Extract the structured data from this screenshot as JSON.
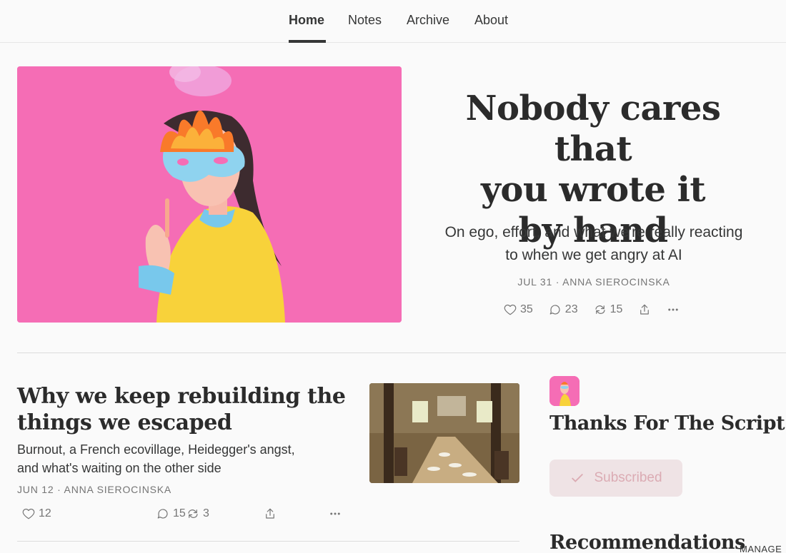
{
  "nav": {
    "items": [
      {
        "label": "Home",
        "active": true
      },
      {
        "label": "Notes",
        "active": false
      },
      {
        "label": "Archive",
        "active": false
      },
      {
        "label": "About",
        "active": false
      }
    ]
  },
  "hero": {
    "title": "Nobody cares that you wrote it by hand",
    "title_lines": [
      "Nobody cares that",
      "you wrote it",
      "by hand"
    ],
    "subtitle_lines": [
      "On ego, effort, and what we're really reacting",
      "to when we get angry at AI"
    ],
    "meta": "JUL 31 · ANNA SIEROCINSKA",
    "likes": "35",
    "comments": "23",
    "restacks": "15",
    "icons": [
      "heart-icon",
      "comment-icon",
      "restack-icon",
      "share-icon",
      "more-icon"
    ]
  },
  "post": {
    "title_lines": [
      "Why we keep rebuilding the",
      "things we escaped"
    ],
    "subtitle_lines": [
      "Burnout, a French ecovillage, Heidegger's angst,",
      "and what's waiting on the other side"
    ],
    "meta": "JUN 12 · ANNA SIEROCINSKA",
    "likes": "12",
    "comments": "15",
    "restacks": "3"
  },
  "sidebar": {
    "publication_name": "Thanks For The Script",
    "subscribe_label": "Subscribed",
    "recommendations_title": "Recommendations",
    "manage_label": "MANAGE"
  },
  "colors": {
    "hero_background": "#f56db5",
    "subscribed_button_bg": "#efe3e5",
    "subscribed_button_text": "#dbabb3",
    "text_primary": "#363737",
    "text_muted": "#757575"
  }
}
